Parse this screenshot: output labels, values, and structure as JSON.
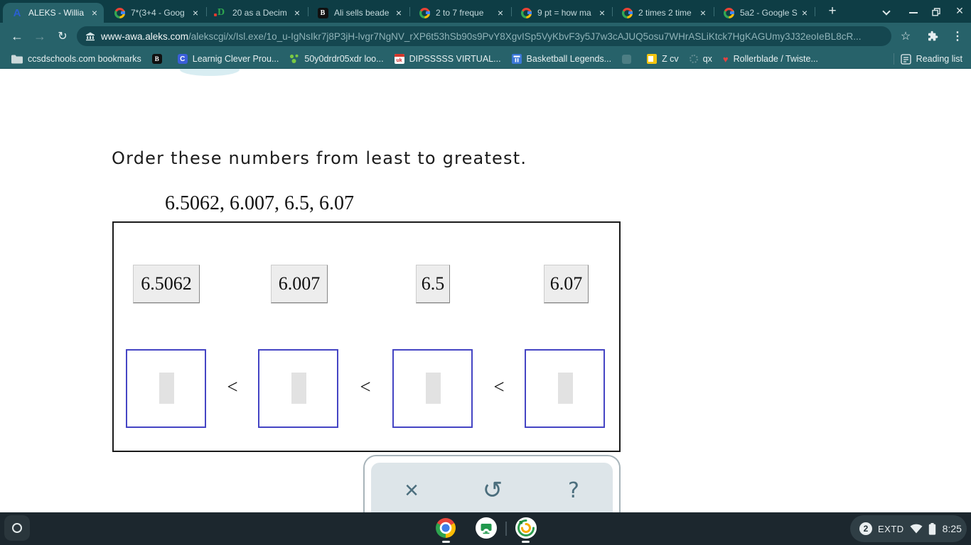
{
  "browser": {
    "tabs": [
      {
        "title": "ALEKS - Willia"
      },
      {
        "title": "7*(3+4 - Goog"
      },
      {
        "title": "20 as a Decim"
      },
      {
        "title": "Ali sells beade"
      },
      {
        "title": "2 to 7 freque"
      },
      {
        "title": "9 pt = how ma"
      },
      {
        "title": "2 times 2 time"
      },
      {
        "title": "5a2 - Google S"
      }
    ],
    "url": {
      "host": "www-awa.aleks.com",
      "path": "/alekscgi/x/Isl.exe/1o_u-IgNsIkr7j8P3jH-lvgr7NgNV_rXP6t53hSb90s9PvY8XgvISp5VyKbvF3y5J7w3cAJUQ5osu7WHrASLiKtck7HgKAGUmy3J32eoIeBL8cR..."
    },
    "bookmarks": [
      {
        "label": "ccsdschools.com bookmarks"
      },
      {
        "label": ""
      },
      {
        "label": "Learnig Clever Prou..."
      },
      {
        "label": "50y0drdr05xdr loo..."
      },
      {
        "label": "DIPSSSSS VIRTUAL..."
      },
      {
        "label": "Basketball Legends..."
      },
      {
        "label": ""
      },
      {
        "label": "Z cv"
      },
      {
        "label": "qx"
      },
      {
        "label": "Rollerblade / Twiste..."
      }
    ],
    "reading_list": "Reading list"
  },
  "problem": {
    "instruction": "Order these numbers from least to greatest.",
    "numbers": "6.5062, 6.007, 6.5, 6.07",
    "tiles": [
      "6.5062",
      "6.007",
      "6.5",
      "6.07"
    ],
    "comparator": "<"
  },
  "panel": {
    "icons": [
      "close",
      "undo",
      "help"
    ]
  },
  "shelf": {
    "notification_count": "2",
    "input_method": "EXTD",
    "time": "8:25"
  },
  "colors": {
    "chrome_frame": "#0e3d45",
    "toolbar": "#27626a",
    "answer_box_border": "#4545c4",
    "shelf": "#1c272e"
  },
  "glyphs": {
    "back": "←",
    "forward": "→",
    "reload": "↻",
    "star": "☆",
    "more": "⋮",
    "new_tab": "+",
    "tab_close": "×",
    "window_close": "×",
    "help": "?",
    "undo": "↺",
    "aleks": "A",
    "b": "B",
    "c": "C",
    "d": "D",
    "uk": "uk",
    "heart": "♥"
  }
}
